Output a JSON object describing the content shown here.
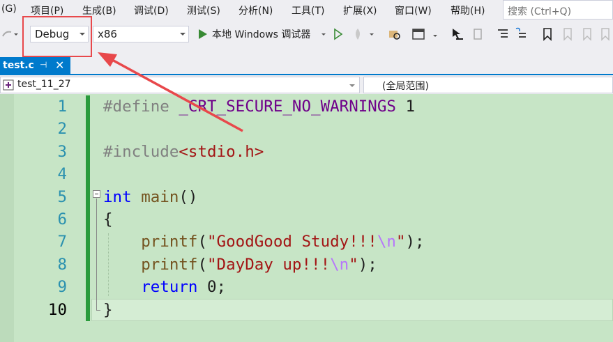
{
  "menu": {
    "items": [
      "(G)",
      "项目(P)",
      "生成(B)",
      "调试(D)",
      "测试(S)",
      "分析(N)",
      "工具(T)",
      "扩展(X)",
      "窗口(W)",
      "帮助(H)"
    ],
    "search_placeholder": "搜索 (Ctrl+Q)"
  },
  "toolbar": {
    "config_value": "Debug",
    "platform_value": "x86",
    "debugger_label": "本地 Windows 调试器"
  },
  "tabs": {
    "active": {
      "name": "test.c",
      "pin": "⊣",
      "close": "✕"
    }
  },
  "navbar": {
    "project": "test_11_27",
    "scope": "(全局范围)"
  },
  "editor": {
    "current_line": 10,
    "lines": [
      {
        "num": "1",
        "tokens": [
          {
            "t": "#define ",
            "c": "pp"
          },
          {
            "t": "_CRT_SECURE_NO_WARNINGS",
            "c": "macro"
          },
          {
            "t": " 1",
            "c": "plain"
          }
        ]
      },
      {
        "num": "2",
        "tokens": []
      },
      {
        "num": "3",
        "tokens": [
          {
            "t": "#include",
            "c": "pp"
          },
          {
            "t": "<stdio.h>",
            "c": "str"
          }
        ]
      },
      {
        "num": "4",
        "tokens": []
      },
      {
        "num": "5",
        "tokens": [
          {
            "t": "int",
            "c": "kw"
          },
          {
            "t": " ",
            "c": "plain"
          },
          {
            "t": "main",
            "c": "fn"
          },
          {
            "t": "()",
            "c": "plain"
          }
        ]
      },
      {
        "num": "6",
        "tokens": [
          {
            "t": "{",
            "c": "plain"
          }
        ]
      },
      {
        "num": "7",
        "tokens": [
          {
            "t": "    ",
            "c": "plain"
          },
          {
            "t": "printf",
            "c": "fn"
          },
          {
            "t": "(",
            "c": "plain"
          },
          {
            "t": "\"GoodGood Study!!!",
            "c": "str"
          },
          {
            "t": "\\n",
            "c": "esc"
          },
          {
            "t": "\"",
            "c": "str"
          },
          {
            "t": ");",
            "c": "plain"
          }
        ]
      },
      {
        "num": "8",
        "tokens": [
          {
            "t": "    ",
            "c": "plain"
          },
          {
            "t": "printf",
            "c": "fn"
          },
          {
            "t": "(",
            "c": "plain"
          },
          {
            "t": "\"DayDay up!!!",
            "c": "str"
          },
          {
            "t": "\\n",
            "c": "esc"
          },
          {
            "t": "\"",
            "c": "str"
          },
          {
            "t": ");",
            "c": "plain"
          }
        ]
      },
      {
        "num": "9",
        "tokens": [
          {
            "t": "    ",
            "c": "plain"
          },
          {
            "t": "return",
            "c": "kw"
          },
          {
            "t": " 0;",
            "c": "plain"
          }
        ]
      },
      {
        "num": "10",
        "tokens": [
          {
            "t": "}",
            "c": "plain"
          }
        ]
      }
    ]
  },
  "colors": {
    "accent": "#007acc",
    "editor_bg": "#c7e5c6",
    "highlight": "#e8484b"
  }
}
